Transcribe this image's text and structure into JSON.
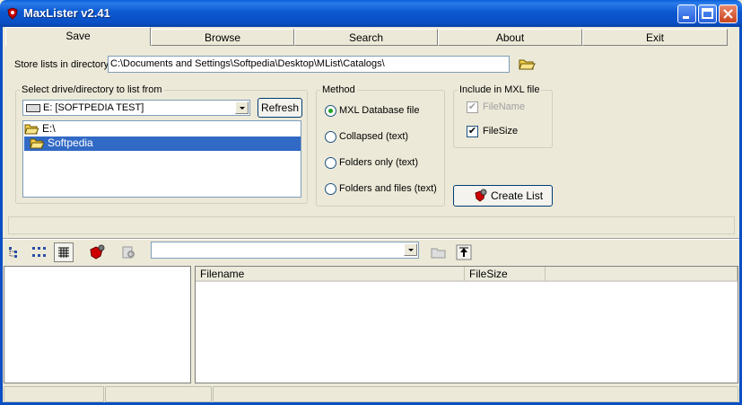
{
  "window": {
    "title": "MaxLister v2.41"
  },
  "tabs": [
    {
      "label": "Save"
    },
    {
      "label": "Browse"
    },
    {
      "label": "Search"
    },
    {
      "label": "About"
    },
    {
      "label": "Exit"
    }
  ],
  "save": {
    "store_label": "Store lists in directory:",
    "store_value": "C:\\Documents and Settings\\Softpedia\\Desktop\\MList\\Catalogs\\",
    "select_group_label": "Select drive/directory to list from",
    "drive_value": "E: [SOFTPEDIA TEST]",
    "refresh_label": "Refresh",
    "tree": [
      {
        "label": "E:\\"
      },
      {
        "label": "Softpedia"
      }
    ],
    "method": {
      "label": "Method",
      "options": [
        {
          "label": "MXL Database file",
          "selected": true
        },
        {
          "label": "Collapsed (text)",
          "selected": false
        },
        {
          "label": "Folders only (text)",
          "selected": false
        },
        {
          "label": "Folders and files (text)",
          "selected": false
        }
      ]
    },
    "include": {
      "label": "Include in MXL file",
      "options": [
        {
          "label": "FileName",
          "checked": true,
          "disabled": true
        },
        {
          "label": "FileSize",
          "checked": true,
          "disabled": false
        }
      ]
    },
    "create_label": "Create List"
  },
  "browse": {
    "columns": [
      {
        "label": "Filename"
      },
      {
        "label": "FileSize"
      }
    ]
  },
  "colors": {
    "selection": "#316ac5",
    "titlebar": "#0a4fc4"
  }
}
